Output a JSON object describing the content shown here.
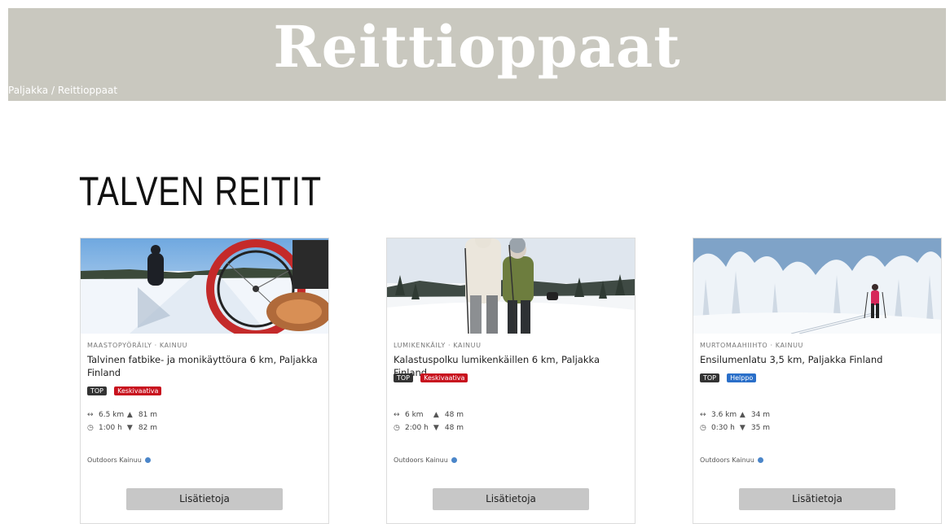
{
  "hero": {
    "title": "Reittioppaat"
  },
  "breadcrumb": {
    "home": "Paljakka",
    "separator": "/",
    "current": "Reittioppaat"
  },
  "section": {
    "title": "TALVEN REITIT"
  },
  "colors": {
    "hero_bg": "#c9c8bf",
    "badge_red": "#c8121e",
    "badge_blue": "#2a6fc9",
    "badge_dark": "#333333",
    "button_bg": "#c7c7c7"
  },
  "cards": [
    {
      "category": "MAASTOPYÖRÄILY · KAINUU",
      "title": "Talvinen fatbike- ja monikäyttöura 6 km, Paljakka Finland",
      "badges": [
        "TOP",
        "Keskivaativa"
      ],
      "distance": "6.5 km",
      "ascent": "81 m",
      "duration": "1:00 h",
      "descent": "82 m",
      "provider": "Outdoors Kainuu",
      "button": "Lisätietoja"
    },
    {
      "category": "LUMIKENKÄILY · KAINUU",
      "title": "Kalastuspolku lumikenkäillen 6 km, Paljakka Finland",
      "badges": [
        "TOP",
        "Keskivaativa"
      ],
      "distance": "6 km",
      "ascent": "48 m",
      "duration": "2:00 h",
      "descent": "48 m",
      "provider": "Outdoors Kainuu",
      "button": "Lisätietoja"
    },
    {
      "category": "MURTOMAAHIIHTO · KAINUU",
      "title": "Ensilumenlatu 3,5 km, Paljakka Finland",
      "badges": [
        "TOP",
        "Helppo"
      ],
      "distance": "3.6 km",
      "ascent": "34 m",
      "duration": "0:30 h",
      "descent": "35 m",
      "provider": "Outdoors Kainuu",
      "button": "Lisätietoja"
    }
  ],
  "icons": {
    "distance": "horizontal-arrows-icon",
    "ascent": "triangle-up-icon",
    "duration": "clock-icon",
    "descent": "triangle-down-icon",
    "verified": "verified-badge-icon"
  }
}
